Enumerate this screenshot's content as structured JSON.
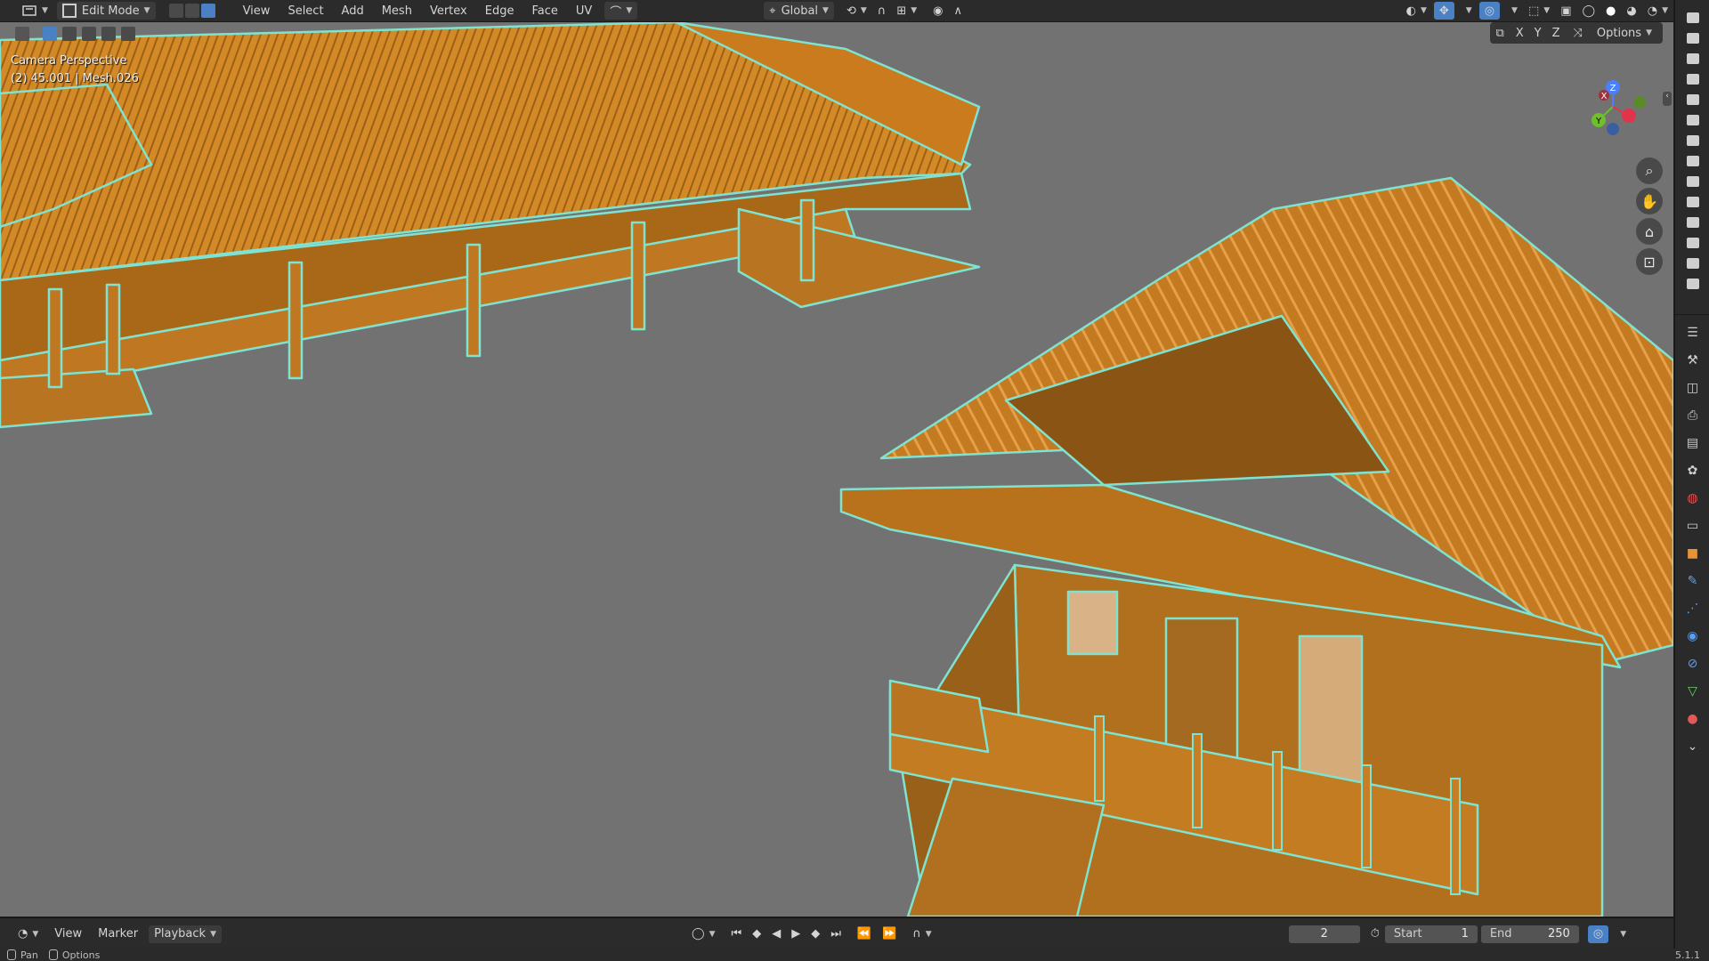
{
  "header": {
    "mode": "Edit Mode",
    "menus": [
      "View",
      "Select",
      "Add",
      "Mesh",
      "Vertex",
      "Edge",
      "Face",
      "UV"
    ],
    "transform_orientation": "Global",
    "options_label": "Options",
    "axis_x": "X",
    "axis_y": "Y",
    "axis_z": "Z"
  },
  "viewport": {
    "view_name": "Camera Perspective",
    "object_info": "(2) 45.001 | Mesh.026",
    "gizmo": {
      "x": "X",
      "y": "Y",
      "z": "Z"
    }
  },
  "timeline": {
    "menus": [
      "View",
      "Marker",
      "Playback"
    ],
    "current_frame": "2",
    "start_label": "Start",
    "start_value": "1",
    "end_label": "End",
    "end_value": "250"
  },
  "status": {
    "pan": "Pan",
    "options": "Options",
    "version": "5.1.1"
  },
  "colors": {
    "mesh_face": "#c97b1e",
    "mesh_edge": "#7fe3d2",
    "viewport_bg": "#727272",
    "active_blue": "#4a80c4"
  },
  "icons": [
    "editor-type-icon",
    "vertex-select-icon",
    "edge-select-icon",
    "face-select-icon",
    "zoom-icon",
    "hand-pan-icon",
    "camera-view-icon",
    "lock-icon",
    "camera-icon",
    "play-icon",
    "clock-icon"
  ]
}
